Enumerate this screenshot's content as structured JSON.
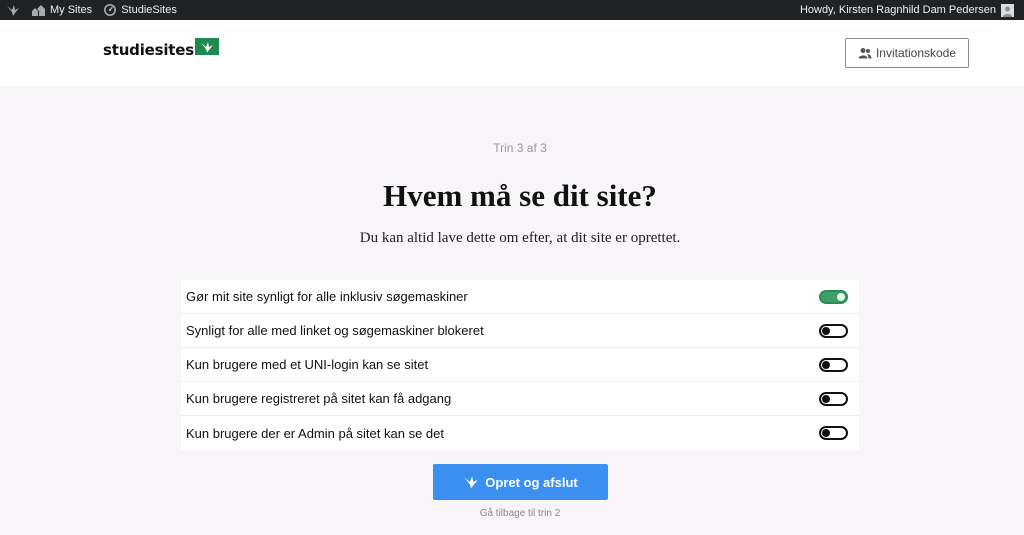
{
  "admin_bar": {
    "my_sites_label": "My Sites",
    "site_label": "StudieSites",
    "greeting": "Howdy, Kirsten Ragnhild Dam Pedersen"
  },
  "header": {
    "logo_text": "studiesites",
    "invite_label": "Invitationskode"
  },
  "main": {
    "step": "Trin 3 af 3",
    "title": "Hvem må se dit site?",
    "subtitle": "Du kan altid lave dette om efter, at dit site er oprettet.",
    "options": [
      {
        "label": "Gør mit site synligt for alle inklusiv søgemaskiner",
        "enabled": true
      },
      {
        "label": "Synligt for alle med linket og søgemaskiner blokeret",
        "enabled": false
      },
      {
        "label": "Kun brugere med et UNI-login kan se sitet",
        "enabled": false
      },
      {
        "label": "Kun brugere registreret på sitet kan få adgang",
        "enabled": false
      },
      {
        "label": "Kun brugere der er Admin på sitet kan se det",
        "enabled": false
      }
    ],
    "submit_label": "Opret og afslut",
    "back_label": "Gå tilbage til trin 2"
  },
  "colors": {
    "admin_bar_bg": "#1d2327",
    "brand_green": "#1f8a4f",
    "toggle_on": "#3f9e69",
    "primary_button": "#3b8ff0",
    "page_bg": "#f7f5f8"
  },
  "icons": {
    "site_logo": "bird-icon",
    "my_sites": "my-sites-icon",
    "site_dashboard": "dashboard-icon",
    "user": "avatar-icon",
    "invite": "users-icon",
    "submit": "bird-icon"
  }
}
